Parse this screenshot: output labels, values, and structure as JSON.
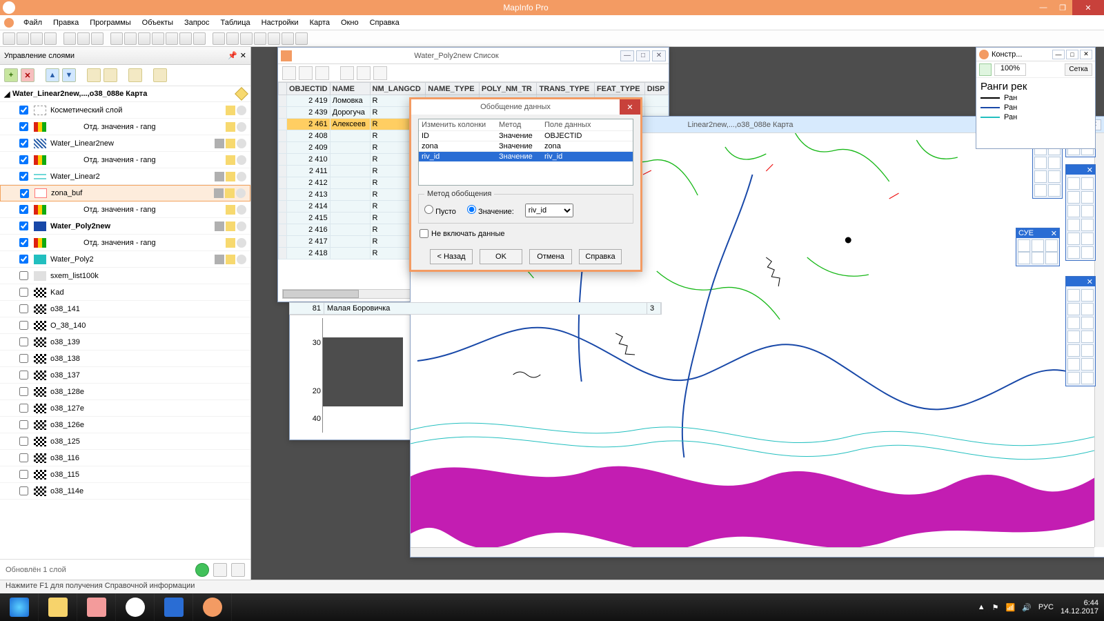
{
  "app": {
    "title": "MapInfo Pro"
  },
  "menu": [
    "Файл",
    "Правка",
    "Программы",
    "Объекты",
    "Запрос",
    "Таблица",
    "Настройки",
    "Карта",
    "Окно",
    "Справка"
  ],
  "layer_panel": {
    "title": "Управление слоями",
    "group": "Water_Linear2new,...,o38_088e Карта",
    "footer": "Обновлён 1 слой",
    "layers": [
      {
        "sym": "cosm",
        "label": "Косметический слой",
        "chk": true,
        "icons": [
          "sun",
          "dot"
        ]
      },
      {
        "sym": "thm",
        "label": "Отд. значения - rang",
        "chk": true,
        "icons": [
          "sun",
          "dot"
        ],
        "indent": true
      },
      {
        "sym": "wlin",
        "label": "Water_Linear2new",
        "chk": true,
        "icons": [
          "pen",
          "sun",
          "dot"
        ]
      },
      {
        "sym": "thm",
        "label": "Отд. значения - rang",
        "chk": true,
        "icons": [
          "sun",
          "dot"
        ],
        "indent": true
      },
      {
        "sym": "wlin2",
        "label": "Water_Linear2",
        "chk": true,
        "icons": [
          "pen",
          "sun",
          "dot"
        ]
      },
      {
        "sym": "zbuf",
        "label": "zona_buf",
        "chk": true,
        "icons": [
          "pen",
          "sun",
          "dot"
        ],
        "sel": true
      },
      {
        "sym": "thm",
        "label": "Отд. значения - rang",
        "chk": true,
        "icons": [
          "sun",
          "dot"
        ],
        "indent": true
      },
      {
        "sym": "wp2n",
        "label": "Water_Poly2new",
        "chk": true,
        "bold": true,
        "icons": [
          "pen",
          "sun",
          "dot"
        ]
      },
      {
        "sym": "thm",
        "label": "Отд. значения - rang",
        "chk": true,
        "icons": [
          "sun",
          "dot"
        ],
        "indent": true
      },
      {
        "sym": "wp2",
        "label": "Water_Poly2",
        "chk": true,
        "icons": [
          "pen",
          "sun",
          "dot"
        ]
      },
      {
        "sym": "gray",
        "label": "sxem_list100k",
        "chk": false,
        "icons": []
      },
      {
        "sym": "chk",
        "label": "Kad",
        "chk": false,
        "icons": []
      },
      {
        "sym": "chk",
        "label": "o38_141",
        "chk": false,
        "icons": []
      },
      {
        "sym": "chk",
        "label": "O_38_140",
        "chk": false,
        "icons": []
      },
      {
        "sym": "chk",
        "label": "o38_139",
        "chk": false,
        "icons": []
      },
      {
        "sym": "chk",
        "label": "o38_138",
        "chk": false,
        "icons": []
      },
      {
        "sym": "chk",
        "label": "o38_137",
        "chk": false,
        "icons": []
      },
      {
        "sym": "chk",
        "label": "o38_128e",
        "chk": false,
        "icons": []
      },
      {
        "sym": "chk",
        "label": "o38_127e",
        "chk": false,
        "icons": []
      },
      {
        "sym": "chk",
        "label": "o38_126e",
        "chk": false,
        "icons": []
      },
      {
        "sym": "chk",
        "label": "o38_125",
        "chk": false,
        "icons": []
      },
      {
        "sym": "chk",
        "label": "o38_116",
        "chk": false,
        "icons": []
      },
      {
        "sym": "chk",
        "label": "o38_115",
        "chk": false,
        "icons": []
      },
      {
        "sym": "chk",
        "label": "o38_114e",
        "chk": false,
        "icons": []
      }
    ]
  },
  "table_window": {
    "title": "Water_Poly2new Список",
    "cols": [
      "OBJECTID",
      "NAME",
      "NM_LANGCD",
      "NAME_TYPE",
      "POLY_NM_TR",
      "TRANS_TYPE",
      "FEAT_TYPE",
      "DISP"
    ],
    "rows": [
      {
        "obj": "2 419",
        "name": "Ломовка",
        "sel": "hl",
        "r": "R"
      },
      {
        "obj": "2 439",
        "name": "Дорогуча",
        "sel": "hl",
        "r": "R"
      },
      {
        "obj": "2 461",
        "name": "Алексеев",
        "sel": "yl",
        "r": "R"
      },
      {
        "obj": "2 408",
        "name": "",
        "r": "R"
      },
      {
        "obj": "2 409",
        "name": "",
        "r": "R"
      },
      {
        "obj": "2 410",
        "name": "",
        "r": "R"
      },
      {
        "obj": "2 411",
        "name": "",
        "r": "R"
      },
      {
        "obj": "2 412",
        "name": "",
        "r": "R"
      },
      {
        "obj": "2 413",
        "name": "",
        "r": "R"
      },
      {
        "obj": "2 414",
        "name": "",
        "r": "R"
      },
      {
        "obj": "2 415",
        "name": "",
        "r": "R"
      },
      {
        "obj": "2 416",
        "name": "",
        "r": "R"
      },
      {
        "obj": "2 417",
        "name": "",
        "r": "R"
      },
      {
        "obj": "2 418",
        "name": "",
        "r": "R"
      }
    ],
    "extra_row": {
      "a": "81",
      "b": "Малая Боровичка",
      "c": "3"
    }
  },
  "ruler_window": {
    "ticks": [
      "30",
      "20",
      "40"
    ]
  },
  "map_window": {
    "title": "Linear2new,...,o38_088e Карта"
  },
  "dialog": {
    "title": "Обобщение данных",
    "col_headers": [
      "Изменить колонки",
      "Метод",
      "Поле данных"
    ],
    "rows": [
      {
        "c": "ID",
        "m": "Значение",
        "d": "OBJECTID"
      },
      {
        "c": "zona",
        "m": "Значение",
        "d": "zona"
      },
      {
        "c": "riv_id",
        "m": "Значение",
        "d": "riv_id",
        "sel": true
      }
    ],
    "fieldset": "Метод обобщения",
    "radio_empty": "Пусто",
    "radio_value": "Значение:",
    "select_value": "riv_id",
    "checkbox": "Не включать данные",
    "btn_back": "< Назад",
    "btn_ok": "OK",
    "btn_cancel": "Отмена",
    "btn_help": "Справка"
  },
  "konstruktor": {
    "title": "Констр...",
    "zoom": "100%",
    "grid_label": "Сетка",
    "legend_title": "Ранги рек",
    "items": [
      {
        "label": "Ран",
        "color": "#000"
      },
      {
        "label": "Ран",
        "color": "#1848a8"
      },
      {
        "label": "Ран",
        "color": "#22bfbf"
      }
    ]
  },
  "cue_title": "СУЕ",
  "statusbar": "Нажмите F1 для получения Справочной информации",
  "taskbar": {
    "lang": "РУС",
    "time": "6:44",
    "date": "14.12.2017"
  }
}
